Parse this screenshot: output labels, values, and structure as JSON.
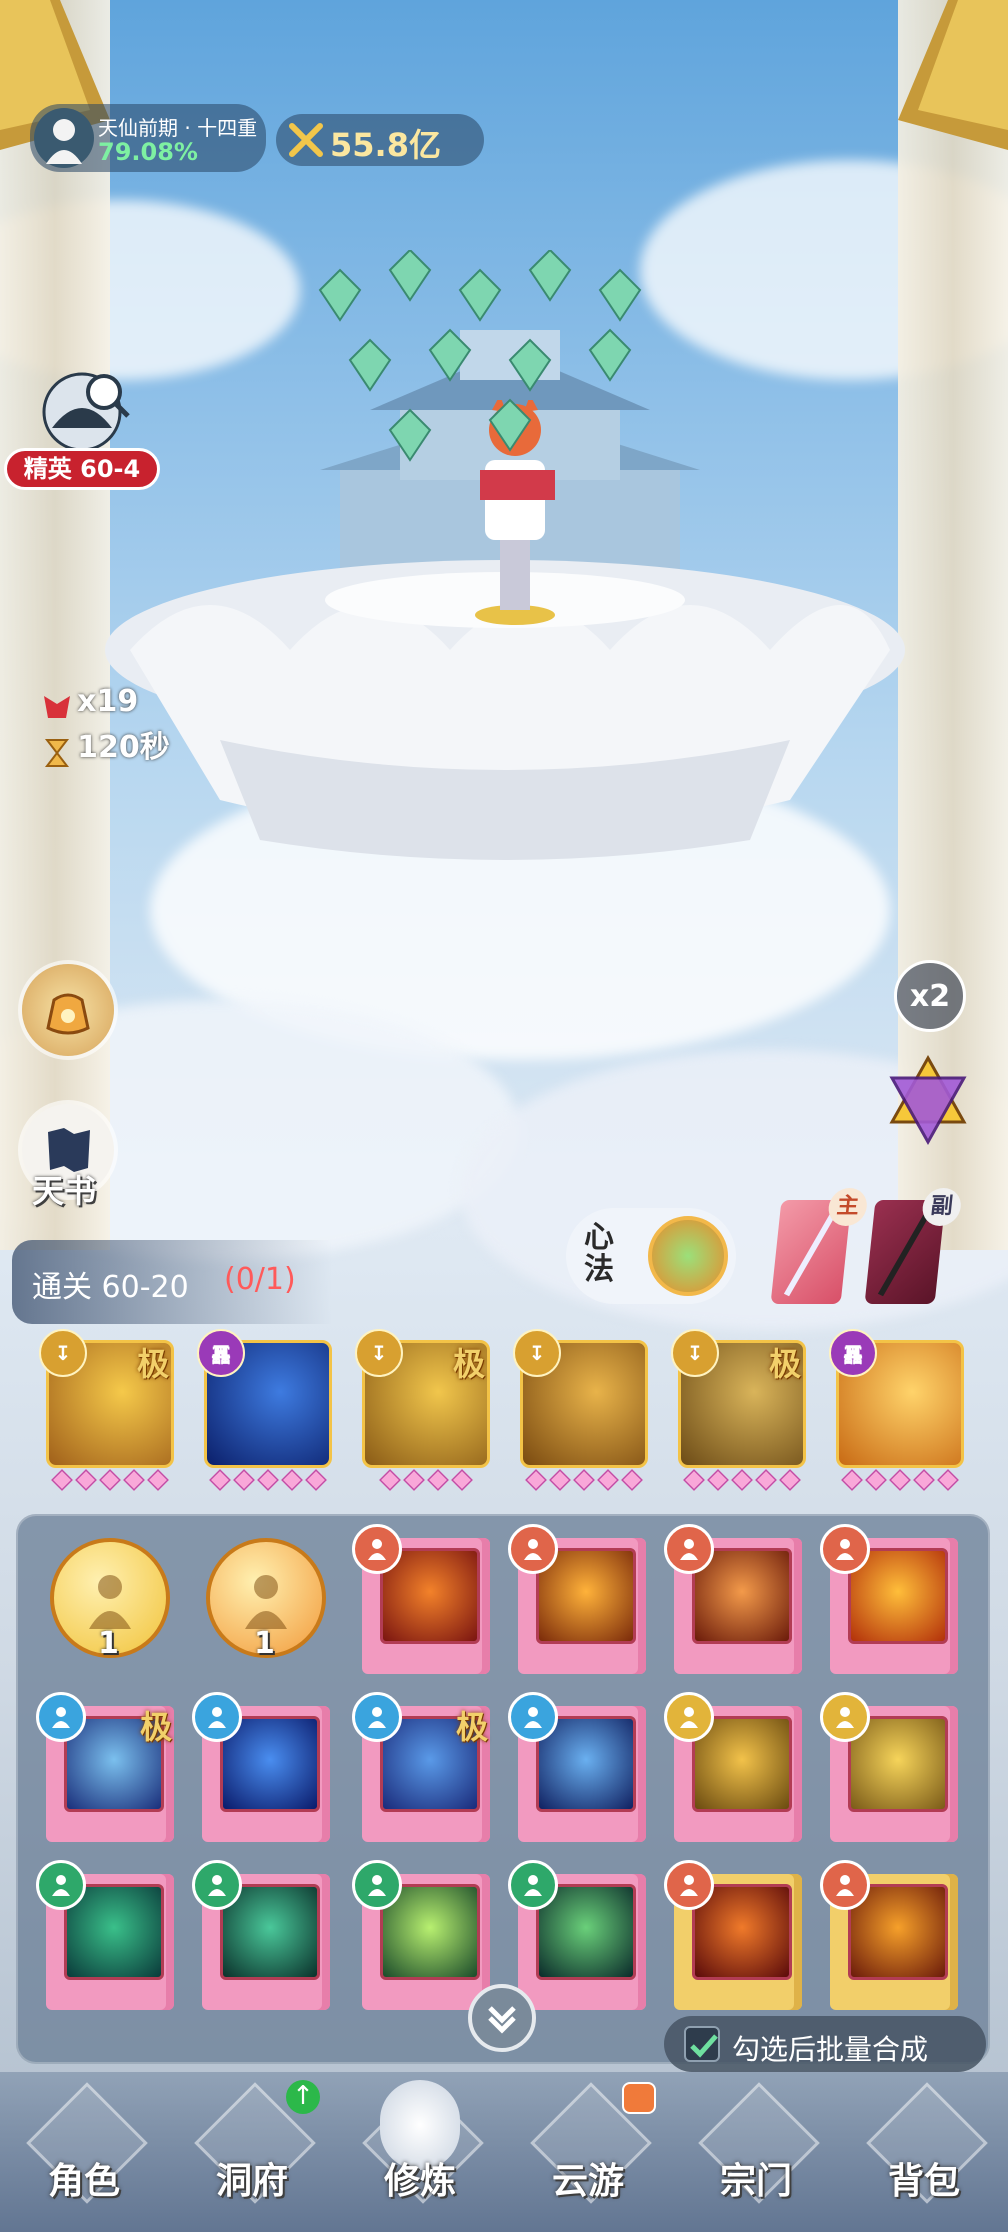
{
  "realm": {
    "title": "天仙前期 · 十四重",
    "percent": "79.08%"
  },
  "power": {
    "value": "55.8亿"
  },
  "stage": {
    "label": "精英 60-4"
  },
  "enemy_counter": {
    "kills": "x19",
    "timer": "120秒"
  },
  "left_buttons": {
    "bag_icon": "pouch-icon",
    "heavenbook_label": "天书"
  },
  "right_buttons": {
    "speed": "x2",
    "star_icon": "hexagram-icon"
  },
  "quest": {
    "text": "通关 60-20",
    "progress": "(0/1)"
  },
  "xinfa": {
    "label": "心法"
  },
  "weapons": {
    "main_label": "主",
    "sub_label": "副"
  },
  "equipped_skills": [
    {
      "badge": "↧",
      "ji": "极",
      "gems": 5,
      "colors": [
        "#f5c94a",
        "#a0601a"
      ]
    },
    {
      "badge": "靐",
      "ji": "",
      "gems": 5,
      "colors": [
        "#3e7be0",
        "#0b1f6a"
      ]
    },
    {
      "badge": "↧",
      "ji": "极",
      "gems": 4,
      "colors": [
        "#f1c64c",
        "#8a5b16"
      ]
    },
    {
      "badge": "↧",
      "ji": "",
      "gems": 5,
      "colors": [
        "#e8b34a",
        "#7a4a10"
      ]
    },
    {
      "badge": "↧",
      "ji": "极",
      "gems": 5,
      "colors": [
        "#d9b45a",
        "#6c4b16"
      ]
    },
    {
      "badge": "靐",
      "ji": "",
      "gems": 5,
      "colors": [
        "#ffd36a",
        "#c86a14"
      ]
    }
  ],
  "inventory": {
    "coins": [
      {
        "count": "1",
        "color": "#f1c33a"
      },
      {
        "count": "1",
        "color": "#f29a3a"
      }
    ],
    "row1_books": [
      {
        "badge_color": "#e0654a",
        "art": [
          "#f3822a",
          "#7a1410"
        ]
      },
      {
        "badge_color": "#e0654a",
        "art": [
          "#ffb23a",
          "#7a2a0a"
        ]
      },
      {
        "badge_color": "#e0654a",
        "art": [
          "#f39a4a",
          "#6a1a0a"
        ]
      },
      {
        "badge_color": "#e0654a",
        "art": [
          "#ffbe3a",
          "#b2300a"
        ]
      }
    ],
    "row2_books": [
      {
        "badge_color": "#3aa4de",
        "ji": "极",
        "art": [
          "#7bc0ee",
          "#1a2e7a"
        ]
      },
      {
        "badge_color": "#3aa4de",
        "ji": "",
        "art": [
          "#4a8ef0",
          "#0a1a6a"
        ]
      },
      {
        "badge_color": "#3aa4de",
        "ji": "极",
        "art": [
          "#5a9ae8",
          "#1a2a7a"
        ]
      },
      {
        "badge_color": "#3aa4de",
        "ji": "",
        "art": [
          "#6ab0f0",
          "#102060"
        ]
      },
      {
        "badge_color": "#e2b43a",
        "ji": "",
        "art": [
          "#f2c24a",
          "#6a4a10"
        ]
      },
      {
        "badge_color": "#e2b43a",
        "ji": "",
        "art": [
          "#f6d45a",
          "#7a5a18"
        ]
      }
    ],
    "row3_books": [
      {
        "badge_color": "#2ea86a",
        "art": [
          "#3ac08a",
          "#0a3a3a"
        ],
        "yellow": false
      },
      {
        "badge_color": "#2ea86a",
        "art": [
          "#4ac89a",
          "#0a302a"
        ],
        "yellow": false
      },
      {
        "badge_color": "#2ea86a",
        "art": [
          "#b8f070",
          "#1a4a2a"
        ],
        "yellow": false
      },
      {
        "badge_color": "#2ea86a",
        "art": [
          "#6ad07a",
          "#0a2a2a"
        ],
        "yellow": false
      },
      {
        "badge_color": "#e0654a",
        "art": [
          "#f07a2a",
          "#5a0a0a"
        ],
        "yellow": true
      },
      {
        "badge_color": "#e0654a",
        "art": [
          "#f6a02a",
          "#6a1a0a"
        ],
        "yellow": true
      }
    ],
    "batch_merge_label": "勾选后批量合成",
    "collapse_icon": "chevron-down-icon"
  },
  "bottom_nav": [
    {
      "label": "角色",
      "badge": ""
    },
    {
      "label": "洞府",
      "badge": "up"
    },
    {
      "label": "修炼",
      "badge": ""
    },
    {
      "label": "云游",
      "badge": "chest"
    },
    {
      "label": "宗门",
      "badge": ""
    },
    {
      "label": "背包",
      "badge": ""
    }
  ],
  "colors": {
    "accent_green": "#7ef0a2",
    "quest_red": "#ff5a5a",
    "stage_red": "#c8222e"
  }
}
